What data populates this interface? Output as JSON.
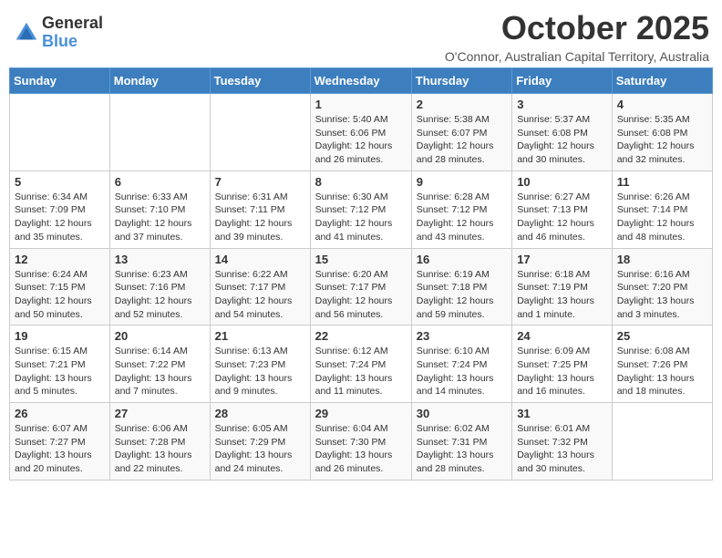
{
  "header": {
    "logo_general": "General",
    "logo_blue": "Blue",
    "month": "October 2025",
    "location": "O'Connor, Australian Capital Territory, Australia"
  },
  "days_of_week": [
    "Sunday",
    "Monday",
    "Tuesday",
    "Wednesday",
    "Thursday",
    "Friday",
    "Saturday"
  ],
  "weeks": [
    [
      {
        "day": "",
        "info": ""
      },
      {
        "day": "",
        "info": ""
      },
      {
        "day": "",
        "info": ""
      },
      {
        "day": "1",
        "info": "Sunrise: 5:40 AM\nSunset: 6:06 PM\nDaylight: 12 hours\nand 26 minutes."
      },
      {
        "day": "2",
        "info": "Sunrise: 5:38 AM\nSunset: 6:07 PM\nDaylight: 12 hours\nand 28 minutes."
      },
      {
        "day": "3",
        "info": "Sunrise: 5:37 AM\nSunset: 6:08 PM\nDaylight: 12 hours\nand 30 minutes."
      },
      {
        "day": "4",
        "info": "Sunrise: 5:35 AM\nSunset: 6:08 PM\nDaylight: 12 hours\nand 32 minutes."
      }
    ],
    [
      {
        "day": "5",
        "info": "Sunrise: 6:34 AM\nSunset: 7:09 PM\nDaylight: 12 hours\nand 35 minutes."
      },
      {
        "day": "6",
        "info": "Sunrise: 6:33 AM\nSunset: 7:10 PM\nDaylight: 12 hours\nand 37 minutes."
      },
      {
        "day": "7",
        "info": "Sunrise: 6:31 AM\nSunset: 7:11 PM\nDaylight: 12 hours\nand 39 minutes."
      },
      {
        "day": "8",
        "info": "Sunrise: 6:30 AM\nSunset: 7:12 PM\nDaylight: 12 hours\nand 41 minutes."
      },
      {
        "day": "9",
        "info": "Sunrise: 6:28 AM\nSunset: 7:12 PM\nDaylight: 12 hours\nand 43 minutes."
      },
      {
        "day": "10",
        "info": "Sunrise: 6:27 AM\nSunset: 7:13 PM\nDaylight: 12 hours\nand 46 minutes."
      },
      {
        "day": "11",
        "info": "Sunrise: 6:26 AM\nSunset: 7:14 PM\nDaylight: 12 hours\nand 48 minutes."
      }
    ],
    [
      {
        "day": "12",
        "info": "Sunrise: 6:24 AM\nSunset: 7:15 PM\nDaylight: 12 hours\nand 50 minutes."
      },
      {
        "day": "13",
        "info": "Sunrise: 6:23 AM\nSunset: 7:16 PM\nDaylight: 12 hours\nand 52 minutes."
      },
      {
        "day": "14",
        "info": "Sunrise: 6:22 AM\nSunset: 7:17 PM\nDaylight: 12 hours\nand 54 minutes."
      },
      {
        "day": "15",
        "info": "Sunrise: 6:20 AM\nSunset: 7:17 PM\nDaylight: 12 hours\nand 56 minutes."
      },
      {
        "day": "16",
        "info": "Sunrise: 6:19 AM\nSunset: 7:18 PM\nDaylight: 12 hours\nand 59 minutes."
      },
      {
        "day": "17",
        "info": "Sunrise: 6:18 AM\nSunset: 7:19 PM\nDaylight: 13 hours\nand 1 minute."
      },
      {
        "day": "18",
        "info": "Sunrise: 6:16 AM\nSunset: 7:20 PM\nDaylight: 13 hours\nand 3 minutes."
      }
    ],
    [
      {
        "day": "19",
        "info": "Sunrise: 6:15 AM\nSunset: 7:21 PM\nDaylight: 13 hours\nand 5 minutes."
      },
      {
        "day": "20",
        "info": "Sunrise: 6:14 AM\nSunset: 7:22 PM\nDaylight: 13 hours\nand 7 minutes."
      },
      {
        "day": "21",
        "info": "Sunrise: 6:13 AM\nSunset: 7:23 PM\nDaylight: 13 hours\nand 9 minutes."
      },
      {
        "day": "22",
        "info": "Sunrise: 6:12 AM\nSunset: 7:24 PM\nDaylight: 13 hours\nand 11 minutes."
      },
      {
        "day": "23",
        "info": "Sunrise: 6:10 AM\nSunset: 7:24 PM\nDaylight: 13 hours\nand 14 minutes."
      },
      {
        "day": "24",
        "info": "Sunrise: 6:09 AM\nSunset: 7:25 PM\nDaylight: 13 hours\nand 16 minutes."
      },
      {
        "day": "25",
        "info": "Sunrise: 6:08 AM\nSunset: 7:26 PM\nDaylight: 13 hours\nand 18 minutes."
      }
    ],
    [
      {
        "day": "26",
        "info": "Sunrise: 6:07 AM\nSunset: 7:27 PM\nDaylight: 13 hours\nand 20 minutes."
      },
      {
        "day": "27",
        "info": "Sunrise: 6:06 AM\nSunset: 7:28 PM\nDaylight: 13 hours\nand 22 minutes."
      },
      {
        "day": "28",
        "info": "Sunrise: 6:05 AM\nSunset: 7:29 PM\nDaylight: 13 hours\nand 24 minutes."
      },
      {
        "day": "29",
        "info": "Sunrise: 6:04 AM\nSunset: 7:30 PM\nDaylight: 13 hours\nand 26 minutes."
      },
      {
        "day": "30",
        "info": "Sunrise: 6:02 AM\nSunset: 7:31 PM\nDaylight: 13 hours\nand 28 minutes."
      },
      {
        "day": "31",
        "info": "Sunrise: 6:01 AM\nSunset: 7:32 PM\nDaylight: 13 hours\nand 30 minutes."
      },
      {
        "day": "",
        "info": ""
      }
    ]
  ]
}
